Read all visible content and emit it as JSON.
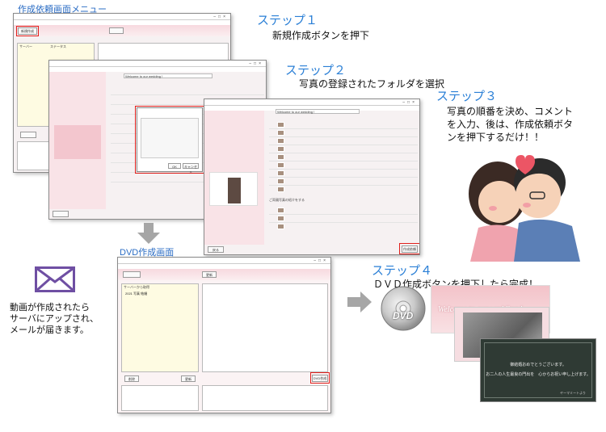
{
  "captions": {
    "menu_screen": "作成依頼画面メニュー",
    "dvd_screen": "DVD作成画面"
  },
  "steps": [
    {
      "title": "ステップ１",
      "desc": [
        "新規作成ボタンを押下"
      ]
    },
    {
      "title": "ステップ２",
      "desc": [
        "写真の登録されたフォルダを選択"
      ]
    },
    {
      "title": "ステップ３",
      "desc": [
        "写真の順番を決め、コメント",
        "を入力、後は、作成依頼ボタ",
        "ンを押下するだけ！！"
      ]
    },
    {
      "title": "ステップ４",
      "desc": [
        "ＤＶＤ作成ボタンを押下したら完成！"
      ]
    }
  ],
  "mail_note": [
    "動画が作成されたら",
    "サーバにアップされ、",
    "メールが届きます。"
  ],
  "window1": {
    "new_button": "新規作成",
    "table_headers": [
      "サーバー",
      "ステータス"
    ],
    "slide_text": "Welcome to our wedding !"
  },
  "window2": {
    "title_field": "Welcome to our wedding !",
    "dialog_ok": "OK",
    "dialog_cancel": "キャンセル"
  },
  "window3": {
    "title_field": "Welcome to our wedding !",
    "request_button": "作成依頼",
    "back_button": "戻る",
    "section_label": "ご両親写真の紹介をする"
  },
  "dvd_window": {
    "create_button": "DVD作成",
    "delete_button": "削除",
    "refresh_button": "更新",
    "top_button": "更新",
    "list_header": "サーバーから取得",
    "list_item": "2021 写真 結婚"
  },
  "dvd_disc_label": "DVD",
  "slides": {
    "title_slide": "Welcome to our wedding !",
    "message_line1": "御結婚おめでとうございます。",
    "message_line2": "お二人の人生最良の門出を　心からお祝い申し上げます。",
    "message_sign": "ヤーマミートより"
  },
  "colors": {
    "step_title": "#2a7fd6",
    "caption": "#2a6cc4",
    "highlight": "#e0201c",
    "mail_icon": "#6f4fa3",
    "arrow": "#a6a6a6"
  },
  "icons": [
    "mail-icon",
    "arrow-down-icon",
    "arrow-right-icon",
    "dvd-disc-icon",
    "couple-illustration"
  ]
}
